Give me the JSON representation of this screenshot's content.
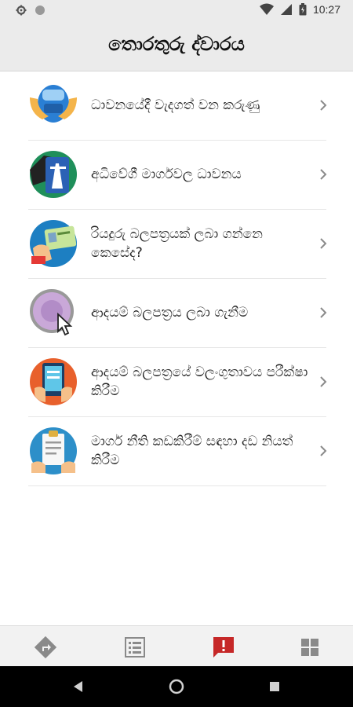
{
  "status_bar": {
    "time": "10:27",
    "icons": [
      "settings-icon",
      "circle-icon",
      "wifi-icon",
      "signal-icon",
      "battery-icon"
    ]
  },
  "app_bar": {
    "title": "තොරතුරු ද්වාරය"
  },
  "list": {
    "items": [
      {
        "label": "ධාවනයේදී වැදගත් වන කරුණු",
        "icon": "car-hands-icon"
      },
      {
        "label": "අධිවේගී මාර්ගවල ධාවනය",
        "icon": "highway-icon"
      },
      {
        "label": "රියදුරු බලපත්‍රයක් ලබා ගන්නෙ කෙසේද?",
        "icon": "license-card-icon"
      },
      {
        "label": "ආදයම් බලපත්‍රය ලබා ගැනීම",
        "icon": "revenue-license-icon"
      },
      {
        "label": "ආදයම් බලපත්‍රයේ වලංගුතාවය පරීක්ෂා කිරීම",
        "icon": "tablet-check-icon"
      },
      {
        "label": "මාර්ග නීති කඩකිරීම් සඳහා දඩ නියත් කිරීම",
        "icon": "clipboard-fine-icon"
      }
    ]
  },
  "bottom_nav": {
    "items": [
      "directions-icon",
      "list-icon",
      "alert-icon",
      "grid-icon"
    ],
    "active": "alert-icon",
    "active_color": "#c62828",
    "inactive_color": "#8a8a8a"
  },
  "system_nav": [
    "back-icon",
    "home-icon",
    "recents-icon"
  ]
}
